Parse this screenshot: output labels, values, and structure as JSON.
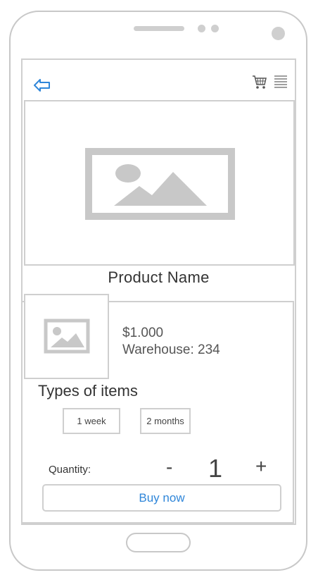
{
  "icons": {
    "back": "back-arrow-icon",
    "cart": "shopping-cart-icon",
    "menu": "list-menu-icon",
    "hero_image": "image-placeholder-icon",
    "thumb_image": "image-placeholder-icon"
  },
  "colors": {
    "accent": "#2f86d9",
    "border": "#cfcfcf",
    "placeholder": "#c8c8c8"
  },
  "product": {
    "name": "Product Name",
    "price": "$1.000",
    "warehouse": "Warehouse: 234"
  },
  "types": {
    "heading": "Types of items",
    "options": [
      "1 week",
      "2 months"
    ]
  },
  "quantity": {
    "label": "Quantity:",
    "minus": "-",
    "value": "1",
    "plus": "+"
  },
  "actions": {
    "buy_label": "Buy now"
  }
}
